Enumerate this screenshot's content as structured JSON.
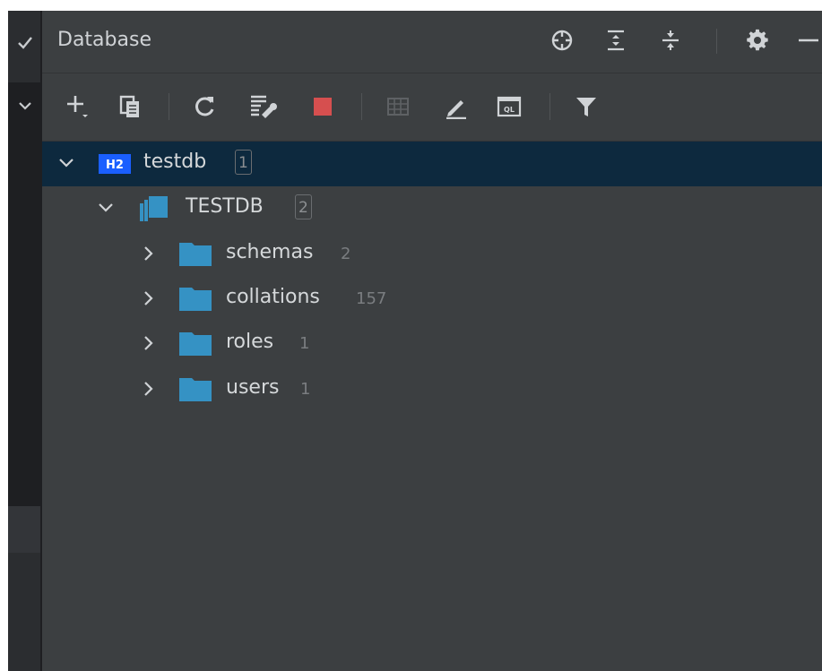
{
  "panel": {
    "title": "Database"
  },
  "header_icons": [
    "crosshair-icon",
    "expand-all-icon",
    "collapse-all-icon",
    "gear-icon",
    "minimize-icon"
  ],
  "toolbar_icons": [
    "add-icon",
    "duplicate-icon",
    "refresh-icon",
    "schema-props-icon",
    "stop-icon",
    "table-icon",
    "edit-icon",
    "query-console-icon",
    "filter-icon"
  ],
  "tree": {
    "root": {
      "badge": "H2",
      "name": "testdb",
      "count": "1"
    },
    "db": {
      "name": "TESTDB",
      "count": "2"
    },
    "items": [
      {
        "name": "schemas",
        "count": "2"
      },
      {
        "name": "collations",
        "count": "157"
      },
      {
        "name": "roles",
        "count": "1"
      },
      {
        "name": "users",
        "count": "1"
      }
    ]
  },
  "colors": {
    "panel_bg": "#3c3f41",
    "selection": "#0d293e",
    "folder": "#3592c4",
    "h2_badge": "#1a5fff",
    "stop": "#d64f4f"
  }
}
